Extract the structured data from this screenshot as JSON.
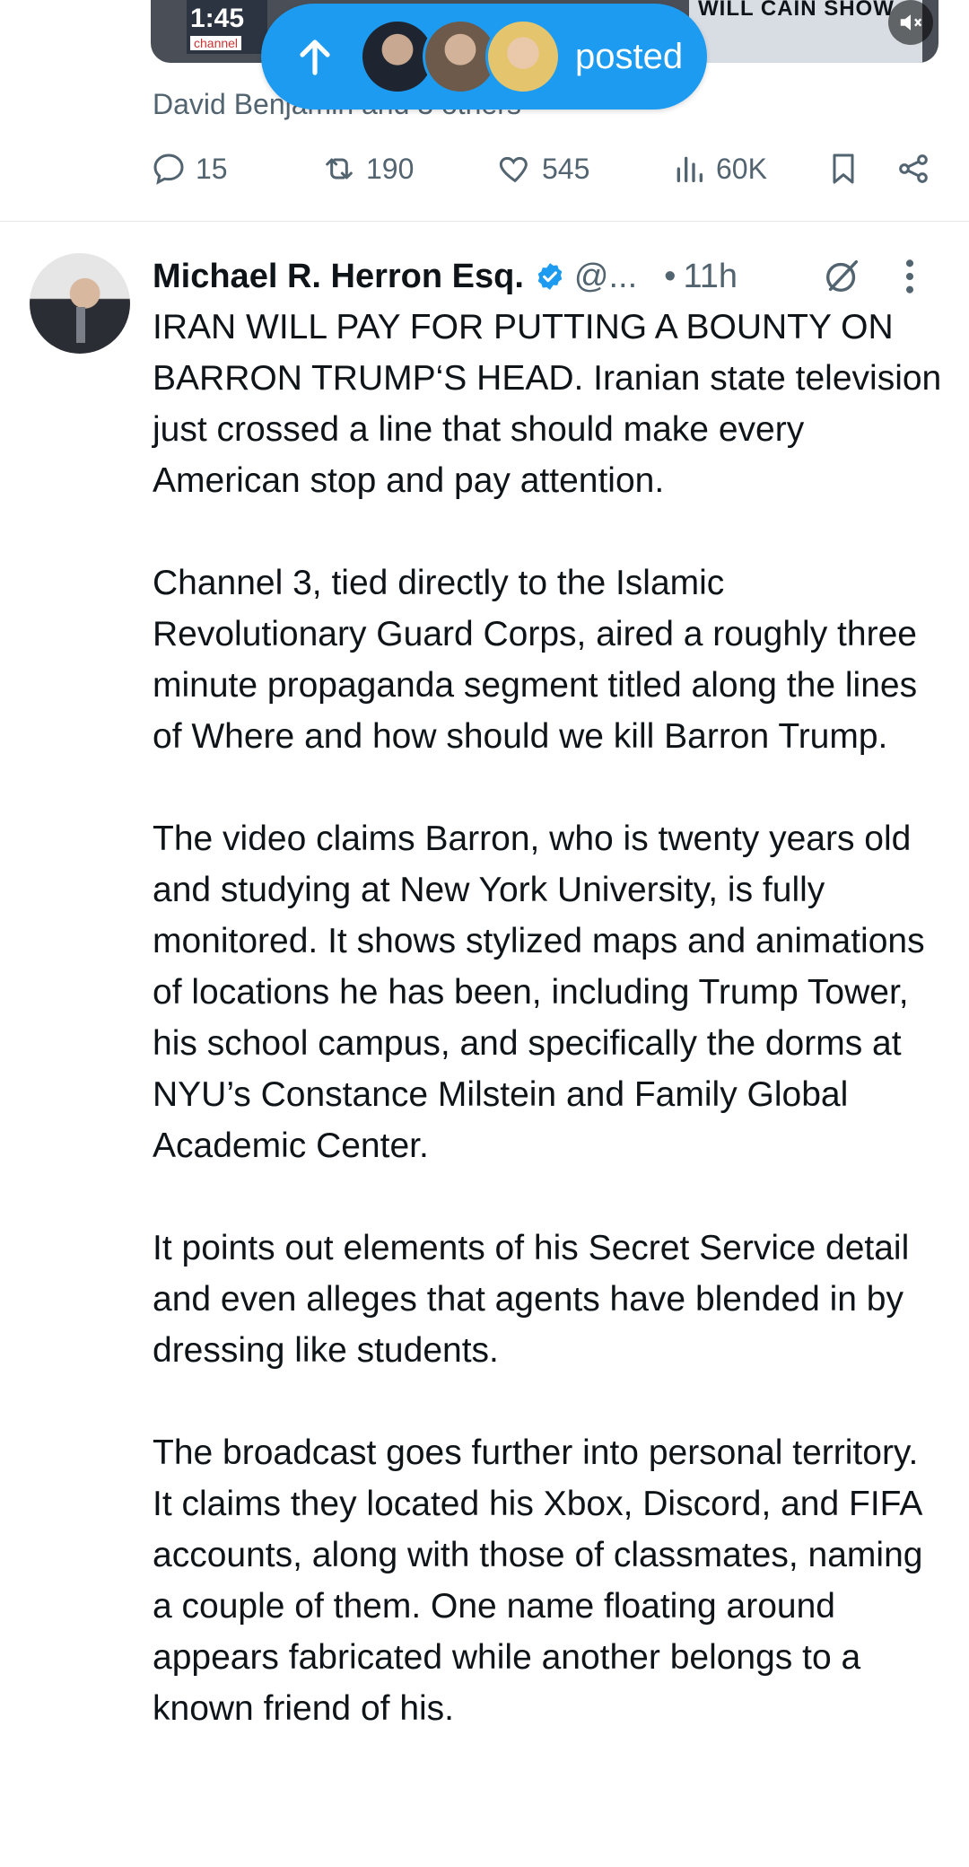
{
  "video_card": {
    "timestamp": "1:45",
    "channel_tag": "channel",
    "banner_text": "WILL CAIN SHOW",
    "reposter_text": "David Benjamin and 3 others"
  },
  "posted_pill": {
    "label": "posted",
    "color": "#1d9bf0"
  },
  "prev_actions": {
    "replies": "15",
    "reposts": "190",
    "likes": "545",
    "views": "60K"
  },
  "tweet": {
    "author_name": "Michael R. Herron Esq.",
    "handle": "@...",
    "separator": "•",
    "time": "11h",
    "verified_color": "#1d9bf0",
    "paragraphs": [
      "IRAN WILL PAY FOR PUTTING A BOUNTY ON BARRON TRUMP‘S HEAD. Iranian state television just crossed a line that should make every American stop and pay attention.",
      "Channel 3, tied directly to the Islamic Revolutionary Guard Corps, aired a roughly three minute propaganda segment titled along the lines of Where and how should we kill Barron Trump.",
      "The video claims Barron, who is twenty years old and studying at New York University, is fully monitored. It shows stylized maps and animations of locations he has been, including Trump Tower, his school campus, and specifically the dorms at NYU’s Constance Milstein and Family Global Academic Center.",
      "It points out elements of his Secret Service detail and even alleges that agents have blended in by dressing like students.",
      "The broadcast goes further into personal territory. It claims they located his Xbox, Discord, and FIFA accounts, along with those of classmates, naming a couple of them. One name floating around appears fabricated while another belongs to a known friend of his."
    ]
  }
}
